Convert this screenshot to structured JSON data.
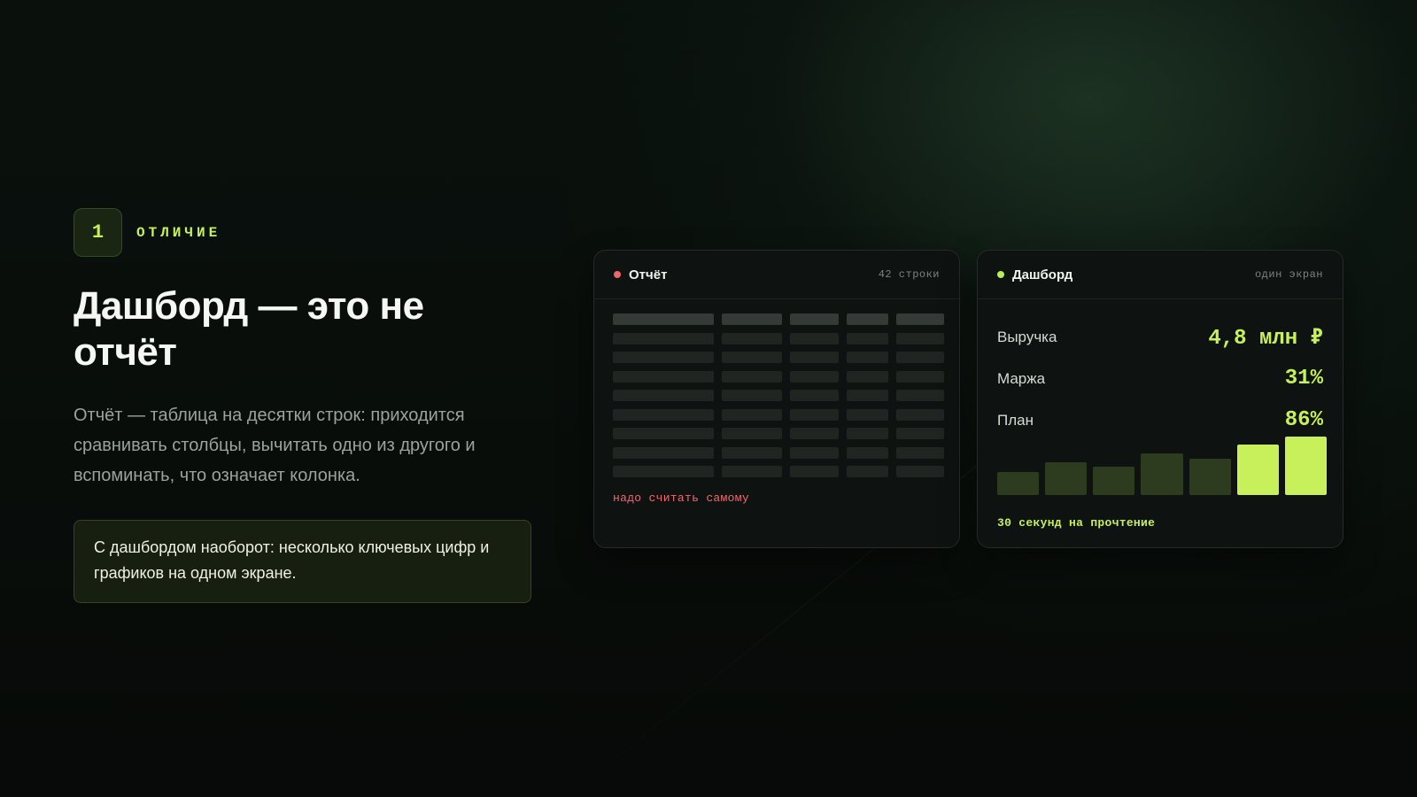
{
  "badge_number": "1",
  "eyebrow": "ОТЛИЧИЕ",
  "title": "Дашборд — это не отчёт",
  "description": "Отчёт — таблица на десятки строк: приходится сравнивать столбцы, вычитать одно из другого и вспоминать, что означает колонка.",
  "callout": "С дашбордом наоборот: несколько ключевых цифр и графиков на одном экране.",
  "report_card": {
    "title": "Отчёт",
    "meta": "42 строки",
    "note": "надо считать самому"
  },
  "dashboard_card": {
    "title": "Дашборд",
    "meta": "один экран",
    "metrics": [
      {
        "label": "Выручка",
        "value": "4,8 млн ₽"
      },
      {
        "label": "Маржа",
        "value": "31%"
      },
      {
        "label": "План",
        "value": "86%"
      }
    ],
    "note": "30 секунд на прочтение"
  },
  "chart_data": {
    "type": "bar",
    "categories": [
      "",
      "",
      "",
      "",
      "",
      "",
      ""
    ],
    "values": [
      40,
      56,
      48,
      71,
      62,
      86,
      100
    ],
    "highlighted": [
      false,
      false,
      false,
      false,
      false,
      true,
      true
    ],
    "ylim": [
      0,
      100
    ]
  },
  "colors": {
    "accent": "#c7f05a",
    "bar_muted": "#2d3b1f",
    "alert": "#f0646e",
    "background": "#070b09"
  }
}
